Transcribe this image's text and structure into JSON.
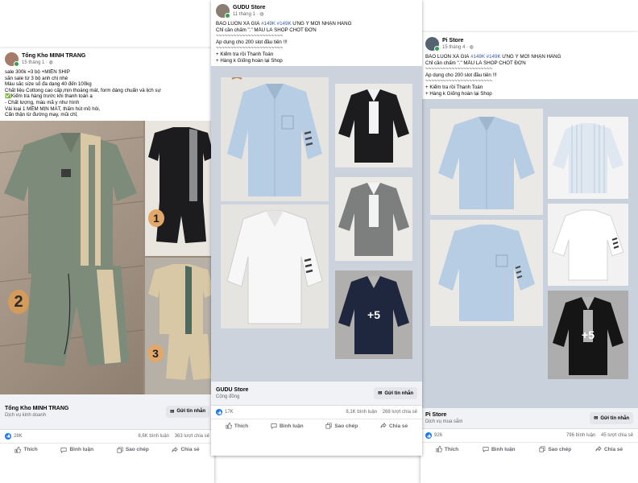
{
  "posts": {
    "p1": {
      "author": "Tổng Kho MINH TRANG",
      "date": "15 tháng 1 · ",
      "lines": [
        "sale 300k =3 bộ +MIỄN SHIP",
        "sẵn sale từ 3 bộ anh chị nhé",
        "Màu sắc size số đa dạng 40 đến 100kg",
        "Chất liệu Cottong cao cấp,mịn thoáng mát, form dáng chuẩn và lịch sự",
        "✅Kiểm tra hàng trước khi thanh toán ạ",
        "- Chất lượng, mẫu mã y như hình",
        "Vải loại 1 MỀM MỊN MÁT, thấm hút mồ hôi,",
        "Cẩn thận từ đường may, mũi chỉ,"
      ],
      "badges": [
        "1",
        "2",
        "3"
      ],
      "card_name": "Tổng Kho MINH TRANG",
      "card_sub": "Dịch vụ kinh doanh",
      "button": "Gửi tin nhắn",
      "reactions": "28K",
      "comments": "8,6K bình luận",
      "shares": "363 lượt chia sẻ",
      "actions": [
        "Thích",
        "Bình luận",
        "Sao chép",
        "Chia sẻ"
      ]
    },
    "p2": {
      "author": "GUDU Store",
      "date": "11 tháng 1 · ",
      "line1_pre": "BẢO LUÔN XẢ GIÁ ",
      "line1_tags": "#149K #149K",
      "line1_post": " ƯNG Ý MỚI NHẬN HÀNG",
      "lines": [
        "Chỉ cần chấm \".\" MẪU LÀ SHOP CHỐT ĐƠN",
        "~~~~~~~~~~~~~~~~~~~~~~~",
        "Áp dụng cho 200 slot đầu tiên !!!",
        "~~~~~~~~~~~~~~~~~~~~~~~",
        "+ Kiểm tra rồi Thanh Toán",
        "+ Hàng k Giống hoàn lại Shop"
      ],
      "more": "+5",
      "card_name": "GUDU Store",
      "card_sub": "Cộng đồng",
      "button": "Gửi tin nhắn",
      "reactions": "17K",
      "comments": "8,1K bình luận",
      "shares": "268 lượt chia sẻ",
      "actions": [
        "Thích",
        "Bình luận",
        "Sao chép",
        "Chia sẻ"
      ]
    },
    "p3": {
      "author": "Pi Store",
      "date": "15 tháng 4 · ",
      "line1_pre": "BẢO LUÔN XẢ GIÁ ",
      "line1_tags": "#149K #149K",
      "line1_post": " ƯNG Ý MỚI NHẬN HÀNG",
      "lines": [
        "Chỉ cần chấm \".\" MẪU LÀ SHOP CHỐT ĐƠN",
        "~~~~~~~~~~~~~~~~~~~~~~~",
        "Áp dụng cho 200 slot đầu tiên !!!",
        "~~~~~~~~~~~~~~~~~~~~~~~",
        "+ Kiểm tra rồi Thanh Toán",
        "+ Hàng k Giống hoàn lại Shop"
      ],
      "more": "+5",
      "card_name": "Pi Store",
      "card_sub": "Dịch vụ mua sắm",
      "button": "Gửi tin nhắn",
      "reactions": "926",
      "comments": "796 bình luận",
      "shares": "45 lượt chia sẻ",
      "actions": [
        "Thích",
        "Bình luận",
        "Sao chép",
        "Chia sẻ"
      ]
    }
  },
  "colors": {
    "accent": "#1877f2",
    "hashtag": "#385898",
    "shirt_blue": "#b7cde3",
    "shirt_white": "#f3f3f3",
    "shirt_black": "#1c1c1e",
    "shirt_grey": "#7d7f7f",
    "shirt_navy": "#283553",
    "polo_green": "#7d8b7a",
    "polo_beige": "#d9c8a5"
  }
}
